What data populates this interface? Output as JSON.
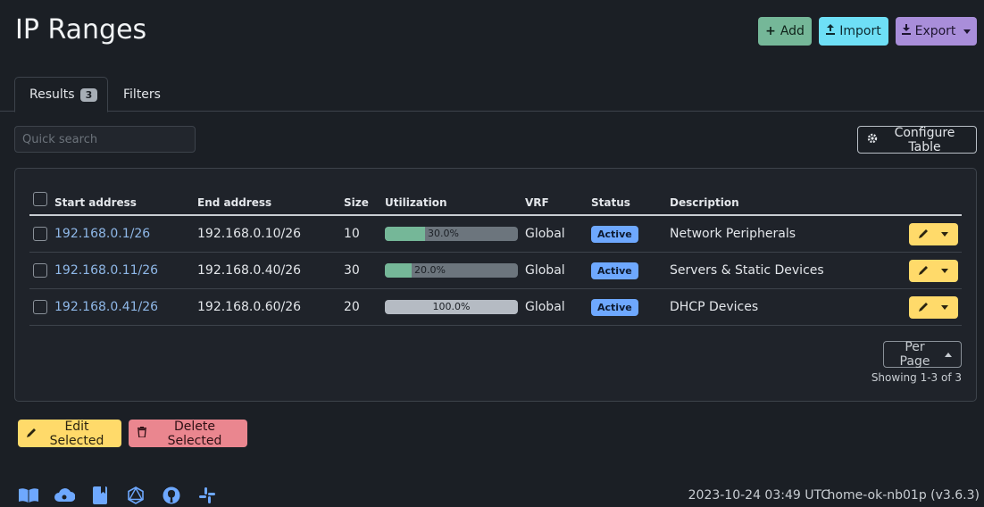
{
  "page": {
    "title": "IP Ranges"
  },
  "actions": {
    "add": "Add",
    "import": "Import",
    "export": "Export"
  },
  "tabs": [
    {
      "label": "Results",
      "count": "3"
    },
    {
      "label": "Filters"
    }
  ],
  "search": {
    "placeholder": "Quick search"
  },
  "configure_table": "Configure Table",
  "table": {
    "columns": [
      "Start address",
      "End address",
      "Size",
      "Utilization",
      "VRF",
      "Status",
      "Description"
    ],
    "rows": [
      {
        "start": "192.168.0.1/26",
        "end": "192.168.0.10/26",
        "size": "10",
        "utilization": "30.0%",
        "utilization_value": 0.3,
        "vrf": "Global",
        "status": "Active",
        "description": "Network Peripherals"
      },
      {
        "start": "192.168.0.11/26",
        "end": "192.168.0.40/26",
        "size": "30",
        "utilization": "20.0%",
        "utilization_value": 0.2,
        "vrf": "Global",
        "status": "Active",
        "description": "Servers & Static Devices"
      },
      {
        "start": "192.168.0.41/26",
        "end": "192.168.0.60/26",
        "size": "20",
        "utilization": "100.0%",
        "utilization_value": 1.0,
        "vrf": "Global",
        "status": "Active",
        "description": "DHCP Devices"
      }
    ]
  },
  "pagination": {
    "per_page": "Per Page",
    "showing": "Showing 1-3 of 3"
  },
  "bulk": {
    "edit": "Edit Selected",
    "delete": "Delete Selected"
  },
  "footer": {
    "icons": [
      "docs-icon",
      "cloud-api-icon",
      "book-icon",
      "graphql-icon",
      "github-icon",
      "slack-icon"
    ],
    "timestamp": "2023-10-24 03:49 UTC",
    "host": "home-ok-nb01p (v3.6.3)"
  },
  "colors": {
    "background": "#1b1f25",
    "success": "#75b798",
    "info": "#6edff6",
    "purple": "#a98eda",
    "warning": "#ffda6a",
    "danger": "#ea868f",
    "primary": "#6ea8fe",
    "link": "#8fb8e8"
  }
}
